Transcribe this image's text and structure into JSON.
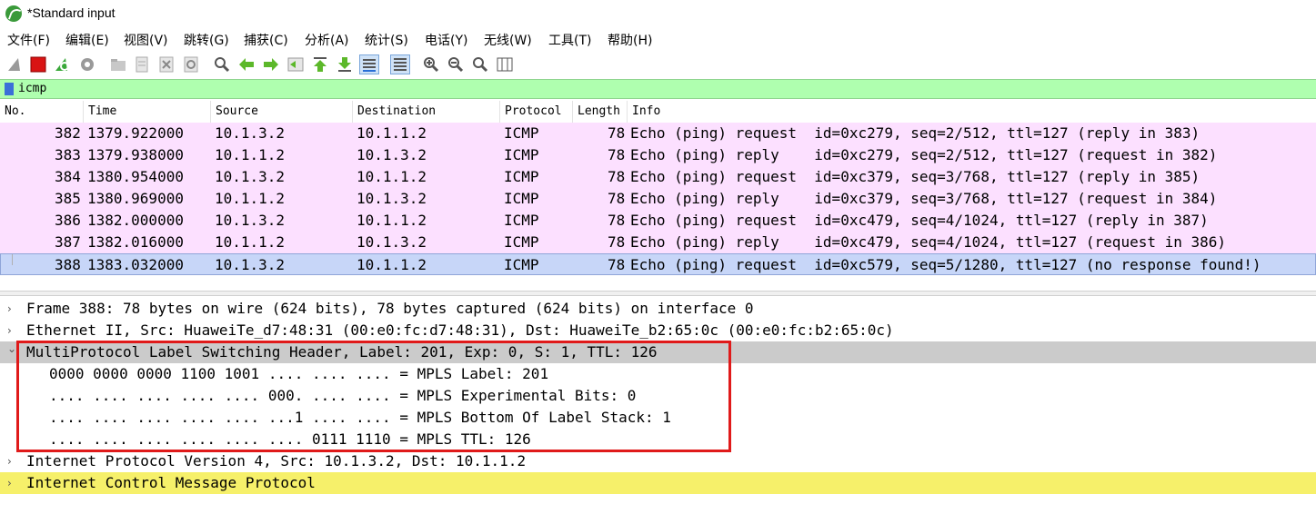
{
  "window": {
    "title": "*Standard input"
  },
  "menu": {
    "items": [
      {
        "label": "文件(F)"
      },
      {
        "label": "编辑(E)"
      },
      {
        "label": "视图(V)"
      },
      {
        "label": "跳转(G)"
      },
      {
        "label": "捕获(C)"
      },
      {
        "label": "分析(A)"
      },
      {
        "label": "统计(S)"
      },
      {
        "label": "电话(Y)"
      },
      {
        "label": "无线(W)"
      },
      {
        "label": "工具(T)"
      },
      {
        "label": "帮助(H)"
      }
    ]
  },
  "toolbar": {
    "icons": [
      "shark-fin-icon",
      "stop-icon",
      "restart-icon",
      "options-gear-icon",
      "open-folder-icon",
      "save-file-icon",
      "close-file-icon",
      "reload-icon",
      "find-icon",
      "back-arrow-icon",
      "forward-arrow-icon",
      "goto-packet-icon",
      "first-packet-icon",
      "last-packet-icon",
      "autoscroll-icon",
      "colorize-icon",
      "zoom-in-icon",
      "zoom-out-icon",
      "zoom-normal-icon",
      "resize-columns-icon"
    ]
  },
  "filter": {
    "value": "icmp"
  },
  "packet_list": {
    "columns": [
      "No.",
      "Time",
      "Source",
      "Destination",
      "Protocol",
      "Length",
      "Info"
    ],
    "rows": [
      {
        "no": "382",
        "time": "1379.922000",
        "source": "10.1.3.2",
        "destination": "10.1.1.2",
        "protocol": "ICMP",
        "length": "78",
        "info": "Echo (ping) request  id=0xc279, seq=2/512, ttl=127 (reply in 383)"
      },
      {
        "no": "383",
        "time": "1379.938000",
        "source": "10.1.1.2",
        "destination": "10.1.3.2",
        "protocol": "ICMP",
        "length": "78",
        "info": "Echo (ping) reply    id=0xc279, seq=2/512, ttl=127 (request in 382)"
      },
      {
        "no": "384",
        "time": "1380.954000",
        "source": "10.1.3.2",
        "destination": "10.1.1.2",
        "protocol": "ICMP",
        "length": "78",
        "info": "Echo (ping) request  id=0xc379, seq=3/768, ttl=127 (reply in 385)"
      },
      {
        "no": "385",
        "time": "1380.969000",
        "source": "10.1.1.2",
        "destination": "10.1.3.2",
        "protocol": "ICMP",
        "length": "78",
        "info": "Echo (ping) reply    id=0xc379, seq=3/768, ttl=127 (request in 384)"
      },
      {
        "no": "386",
        "time": "1382.000000",
        "source": "10.1.3.2",
        "destination": "10.1.1.2",
        "protocol": "ICMP",
        "length": "78",
        "info": "Echo (ping) request  id=0xc479, seq=4/1024, ttl=127 (reply in 387)"
      },
      {
        "no": "387",
        "time": "1382.016000",
        "source": "10.1.1.2",
        "destination": "10.1.3.2",
        "protocol": "ICMP",
        "length": "78",
        "info": "Echo (ping) reply    id=0xc479, seq=4/1024, ttl=127 (request in 386)"
      },
      {
        "no": "388",
        "time": "1383.032000",
        "source": "10.1.3.2",
        "destination": "10.1.1.2",
        "protocol": "ICMP",
        "length": "78",
        "info": "Echo (ping) request  id=0xc579, seq=5/1280, ttl=127 (no response found!)"
      }
    ],
    "selected_no": "388"
  },
  "details": {
    "rows": [
      {
        "text": "Frame 388: 78 bytes on wire (624 bits), 78 bytes captured (624 bits) on interface 0",
        "arrow": "›"
      },
      {
        "text": "Ethernet II, Src: HuaweiTe_d7:48:31 (00:e0:fc:d7:48:31), Dst: HuaweiTe_b2:65:0c (00:e0:fc:b2:65:0c)",
        "arrow": "›"
      },
      {
        "text": "MultiProtocol Label Switching Header, Label: 201, Exp: 0, S: 1, TTL: 126",
        "arrow": "⌄"
      },
      {
        "text": "0000 0000 0000 1100 1001 .... .... .... = MPLS Label: 201",
        "arrow": ""
      },
      {
        "text": ".... .... .... .... .... 000. .... .... = MPLS Experimental Bits: 0",
        "arrow": ""
      },
      {
        "text": ".... .... .... .... .... ...1 .... .... = MPLS Bottom Of Label Stack: 1",
        "arrow": ""
      },
      {
        "text": ".... .... .... .... .... .... 0111 1110 = MPLS TTL: 126",
        "arrow": ""
      },
      {
        "text": "Internet Protocol Version 4, Src: 10.1.3.2, Dst: 10.1.1.2",
        "arrow": "›"
      },
      {
        "text": "Internet Control Message Protocol",
        "arrow": "›"
      }
    ]
  },
  "colors": {
    "icmp_row": "#fce0ff",
    "selected_row": "#c7d6f8",
    "filter_ok": "#afffaf",
    "highlight_box": "#e01a1a",
    "icmp_detail": "#f6f06a"
  }
}
